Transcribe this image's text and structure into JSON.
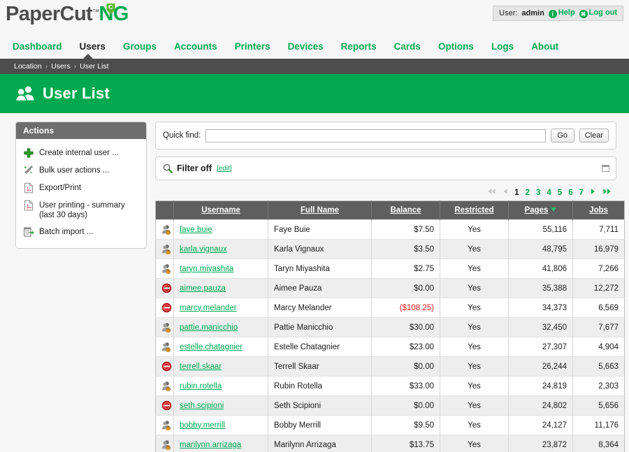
{
  "brand": {
    "name_dark": "PaperCut",
    "name_green": "NG",
    "tm": "™",
    "leaf_icon": "leaf-tag-icon"
  },
  "userbar": {
    "user_label": "User:",
    "user_name": "admin",
    "help_label": "Help",
    "help_icon": "info-icon",
    "logout_label": "Log out",
    "logout_icon": "close-circle-icon"
  },
  "nav": {
    "items": [
      {
        "label": "Dashboard",
        "active": false
      },
      {
        "label": "Users",
        "active": true
      },
      {
        "label": "Groups",
        "active": false
      },
      {
        "label": "Accounts",
        "active": false
      },
      {
        "label": "Printers",
        "active": false
      },
      {
        "label": "Devices",
        "active": false
      },
      {
        "label": "Reports",
        "active": false
      },
      {
        "label": "Cards",
        "active": false
      },
      {
        "label": "Options",
        "active": false
      },
      {
        "label": "Logs",
        "active": false
      },
      {
        "label": "About",
        "active": false
      }
    ]
  },
  "breadcrumb": {
    "items": [
      "Location",
      "Users",
      "User List"
    ],
    "separator": "›"
  },
  "page": {
    "title": "User List",
    "title_icon": "users-group-icon",
    "accent_color": "#00a94f",
    "header_bg": "#00a94f"
  },
  "actions": {
    "title": "Actions",
    "items": [
      {
        "label": "Create internal user ...",
        "icon": "plus-icon"
      },
      {
        "label": "Bulk user actions ...",
        "icon": "magic-wand-icon"
      },
      {
        "label": "Export/Print",
        "icon": "pdf-file-icon"
      },
      {
        "label": "User printing - summary (last 30 days)",
        "icon": "pdf-file-icon"
      },
      {
        "label": "Batch import ...",
        "icon": "batch-import-icon"
      }
    ]
  },
  "quickfind": {
    "label": "Quick find:",
    "value": "",
    "placeholder": "",
    "go_label": "Go",
    "clear_label": "Clear"
  },
  "filter": {
    "icon": "magnifier-icon",
    "label": "Filter off",
    "edit_label": "[edit]",
    "collapse_icon": "restore-window-icon"
  },
  "pagination": {
    "first_icon": "double-left-arrow-icon",
    "prev_icon": "left-arrow-icon",
    "next_icon": "right-arrow-icon",
    "last_icon": "double-right-arrow-icon",
    "first_enabled": false,
    "prev_enabled": false,
    "pages": [
      "1",
      "2",
      "3",
      "4",
      "5",
      "6",
      "7"
    ],
    "current_page": "1"
  },
  "table": {
    "columns": [
      {
        "key": "icon",
        "label": "",
        "sortable": false
      },
      {
        "key": "username",
        "label": "Username",
        "sortable": true
      },
      {
        "key": "fullname",
        "label": "Full Name",
        "sortable": true
      },
      {
        "key": "balance",
        "label": "Balance",
        "sortable": true
      },
      {
        "key": "restricted",
        "label": "Restricted",
        "sortable": true
      },
      {
        "key": "pages",
        "label": "Pages",
        "sortable": true,
        "sorted": "desc"
      },
      {
        "key": "jobs",
        "label": "Jobs",
        "sortable": true
      }
    ],
    "rows": [
      {
        "icon": "user-locked-icon",
        "username": "faye.buie",
        "fullname": "Faye Buie",
        "balance": "$7.50",
        "balance_negative": false,
        "restricted": "Yes",
        "pages": "55,116",
        "jobs": "7,711"
      },
      {
        "icon": "user-locked-icon",
        "username": "karla.vignaux",
        "fullname": "Karla Vignaux",
        "balance": "$3.50",
        "balance_negative": false,
        "restricted": "Yes",
        "pages": "48,795",
        "jobs": "16,979"
      },
      {
        "icon": "user-locked-icon",
        "username": "taryn.miyashita",
        "fullname": "Taryn Miyashita",
        "balance": "$2.75",
        "balance_negative": false,
        "restricted": "Yes",
        "pages": "41,806",
        "jobs": "7,266"
      },
      {
        "icon": "user-disabled-icon",
        "username": "aimee.pauza",
        "fullname": "Aimee Pauza",
        "balance": "$0.00",
        "balance_negative": false,
        "restricted": "Yes",
        "pages": "35,388",
        "jobs": "12,272"
      },
      {
        "icon": "user-disabled-icon",
        "username": "marcy.melander",
        "fullname": "Marcy Melander",
        "balance": "($108.25)",
        "balance_negative": true,
        "restricted": "Yes",
        "pages": "34,373",
        "jobs": "6,569"
      },
      {
        "icon": "user-locked-icon",
        "username": "pattie.manicchio",
        "fullname": "Pattie Manicchio",
        "balance": "$30.00",
        "balance_negative": false,
        "restricted": "Yes",
        "pages": "32,450",
        "jobs": "7,677"
      },
      {
        "icon": "user-locked-icon",
        "username": "estelle.chatagnier",
        "fullname": "Estelle Chatagnier",
        "balance": "$23.00",
        "balance_negative": false,
        "restricted": "Yes",
        "pages": "27,307",
        "jobs": "4,904"
      },
      {
        "icon": "user-disabled-icon",
        "username": "terrell.skaar",
        "fullname": "Terrell Skaar",
        "balance": "$0.00",
        "balance_negative": false,
        "restricted": "Yes",
        "pages": "26,244",
        "jobs": "5,663"
      },
      {
        "icon": "user-locked-icon",
        "username": "rubin.rotella",
        "fullname": "Rubin Rotella",
        "balance": "$33.00",
        "balance_negative": false,
        "restricted": "Yes",
        "pages": "24,819",
        "jobs": "2,303"
      },
      {
        "icon": "user-disabled-icon",
        "username": "seth.scipioni",
        "fullname": "Seth Scipioni",
        "balance": "$0.00",
        "balance_negative": false,
        "restricted": "Yes",
        "pages": "24,802",
        "jobs": "5,656"
      },
      {
        "icon": "user-locked-icon",
        "username": "bobby.merrill",
        "fullname": "Bobby Merrill",
        "balance": "$9.50",
        "balance_negative": false,
        "restricted": "Yes",
        "pages": "24,127",
        "jobs": "11,176"
      },
      {
        "icon": "user-locked-icon",
        "username": "marilynn.arrizaga",
        "fullname": "Marilynn Arrizaga",
        "balance": "$13.75",
        "balance_negative": false,
        "restricted": "Yes",
        "pages": "23,872",
        "jobs": "8,364"
      }
    ]
  }
}
